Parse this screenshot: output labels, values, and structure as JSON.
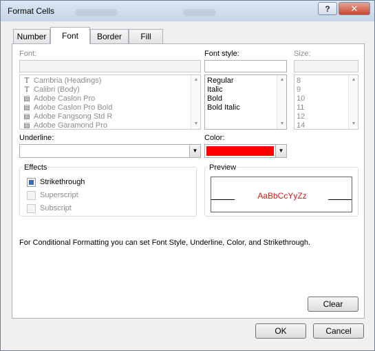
{
  "window": {
    "title": "Format Cells",
    "help_label": "?",
    "close_label": "✕"
  },
  "tabs": [
    {
      "label": "Number"
    },
    {
      "label": "Font",
      "active": true
    },
    {
      "label": "Border"
    },
    {
      "label": "Fill"
    }
  ],
  "font": {
    "label": "Font:",
    "value": "",
    "items": [
      {
        "glyph": "T",
        "label": "Cambria (Headings)"
      },
      {
        "glyph": "T",
        "label": "Calibri (Body)"
      },
      {
        "glyph": "▤",
        "label": "Adobe Caslon Pro"
      },
      {
        "glyph": "▤",
        "label": "Adobe Caslon Pro Bold"
      },
      {
        "glyph": "▤",
        "label": "Adobe Fangsong Std R"
      },
      {
        "glyph": "▤",
        "label": "Adobe Garamond Pro"
      }
    ]
  },
  "font_style": {
    "label": "Font style:",
    "value": "",
    "items": [
      "Regular",
      "Italic",
      "Bold",
      "Bold Italic"
    ]
  },
  "size": {
    "label": "Size:",
    "value": "",
    "items": [
      "8",
      "9",
      "10",
      "11",
      "12",
      "14"
    ]
  },
  "underline": {
    "label": "Underline:",
    "value": ""
  },
  "color": {
    "label": "Color:",
    "swatch": "#ff0000"
  },
  "effects": {
    "label": "Effects",
    "strikethrough": {
      "label": "Strikethrough",
      "checked": true
    },
    "superscript": {
      "label": "Superscript",
      "checked": false
    },
    "subscript": {
      "label": "Subscript",
      "checked": false
    }
  },
  "preview": {
    "label": "Preview",
    "sample": "AaBbCcYyZz",
    "sample_color": "#e51414"
  },
  "info_text": "For Conditional Formatting you can set Font Style, Underline, Color, and Strikethrough.",
  "buttons": {
    "clear": "Clear",
    "ok": "OK",
    "cancel": "Cancel"
  }
}
